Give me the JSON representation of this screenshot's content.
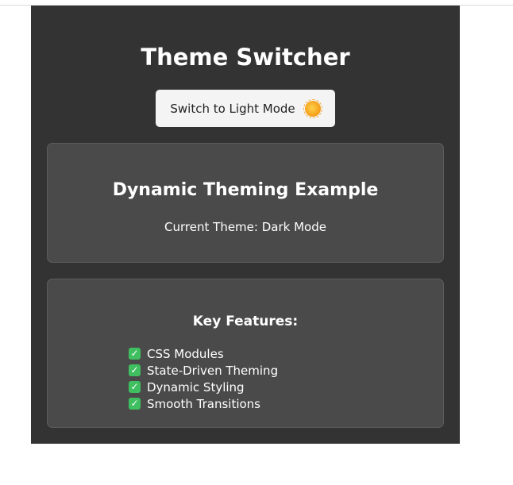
{
  "app": {
    "title": "Theme Switcher",
    "toggle_label": "Switch to Light Mode",
    "toggle_icon": "sun-icon"
  },
  "theme_card": {
    "title": "Dynamic Theming Example",
    "current_theme_text": "Current Theme: Dark Mode"
  },
  "features_card": {
    "title": "Key Features:",
    "items": [
      {
        "label": "CSS Modules",
        "icon": "check-icon"
      },
      {
        "label": "State-Driven Theming",
        "icon": "check-icon"
      },
      {
        "label": "Dynamic Styling",
        "icon": "check-icon"
      },
      {
        "label": "Smooth Transitions",
        "icon": "check-icon"
      }
    ]
  },
  "colors": {
    "background": "#333333",
    "card": "#4a4a4a",
    "button": "#f4f4f4",
    "check": "#3fbf5f"
  }
}
